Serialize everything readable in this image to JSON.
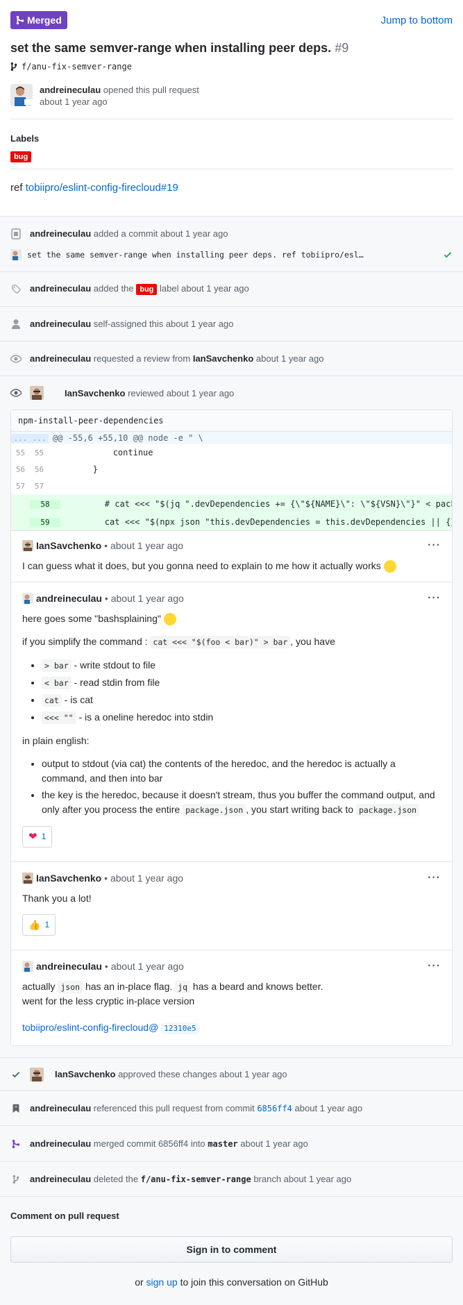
{
  "header": {
    "status": "Merged",
    "jump_link": "Jump to bottom",
    "title": "set the same semver-range when installing peer deps.",
    "number": "#9",
    "branch": "f/anu-fix-semver-range",
    "author": "andreineculau",
    "opened_text": "opened this pull request",
    "opened_time": "about 1 year ago"
  },
  "labels": {
    "heading": "Labels",
    "bug": "bug"
  },
  "body": {
    "prefix": "ref",
    "ref_link": "tobiipro/eslint-config-firecloud#19"
  },
  "timeline": {
    "commit": {
      "user": "andreineculau",
      "action": "added a commit",
      "time": "about 1 year ago",
      "message": "set the same semver-range when installing peer deps. ref tobiipro/esl…"
    },
    "labeled": {
      "user": "andreineculau",
      "action": "added the",
      "label": "bug",
      "suffix": "label about 1 year ago"
    },
    "assigned": {
      "user": "andreineculau",
      "action": "self-assigned this about 1 year ago"
    },
    "review_request": {
      "user": "andreineculau",
      "action": "requested a review from",
      "reviewer": "IanSavchenko",
      "time": "about 1 year ago"
    },
    "reviewed": {
      "user": "IanSavchenko",
      "action": "reviewed about 1 year ago"
    }
  },
  "review": {
    "file": "npm-install-peer-dependencies",
    "hunk": "@@ -55,6 +55,10 @@ node -e \" \\",
    "hunk_dots": "...",
    "rows": [
      {
        "l": "55",
        "r": "55",
        "code": "            continue"
      },
      {
        "l": "56",
        "r": "56",
        "code": "        }"
      },
      {
        "l": "57",
        "r": "57",
        "code": ""
      }
    ],
    "added": [
      {
        "r": "58",
        "code": "        # cat <<< \"$(jq \".devDependencies += {\\\"${NAME}\\\": \\\"${VSN}\\\"}\" < package.json)\" > package.json"
      },
      {
        "r": "59",
        "code": "        cat <<< \"$(npx json \"this.devDependencies = this.devDependencies || {}\" < package.json)\" > package.json"
      }
    ],
    "comments": [
      {
        "user": "IanSavchenko",
        "meta": "• about 1 year ago",
        "text": "I can guess what it does, but you gonna need to explain to me how it actually works"
      },
      {
        "user": "andreineculau",
        "meta": "• about 1 year ago",
        "intro": "here goes some \"bashsplaining\"",
        "simplify_pre": "if you simplify the command :",
        "simplify_code": "cat <<< \"$(foo < bar)\" > bar",
        "simplify_post": ", you have",
        "items": [
          {
            "code": "> bar",
            "text": "- write stdout to file"
          },
          {
            "code": "< bar",
            "text": "- read stdin from file"
          },
          {
            "code": "cat",
            "text": "- is cat"
          },
          {
            "code": "<<< \"\"",
            "text": "- is a oneline heredoc into stdin"
          }
        ],
        "plain": "in plain english:",
        "bullet1": "output to stdout (via cat) the contents of the heredoc, and the heredoc is actually a command, and then into bar",
        "bullet2_pre": "the key is the heredoc, because it doesn't stream, thus you buffer the command output, and only after you process the entire",
        "bullet2_code1": "package.json",
        "bullet2_mid": ", you start writing back to",
        "bullet2_code2": "package.json",
        "reaction_count": "1"
      },
      {
        "user": "IanSavchenko",
        "meta": "• about 1 year ago",
        "text": "Thank you a lot!",
        "reaction_count": "1"
      },
      {
        "user": "andreineculau",
        "meta": "• about 1 year ago",
        "pre": "actually",
        "code1": "json",
        "mid": "has an in-place flag.",
        "code2": "jq",
        "post": "has a beard and knows better.",
        "line2": "went for the less cryptic in-place version",
        "ref": "tobiipro/eslint-config-firecloud@",
        "sha": "12310e5"
      }
    ]
  },
  "events": {
    "approved": {
      "user": "IanSavchenko",
      "action": "approved these changes about 1 year ago"
    },
    "referenced": {
      "user": "andreineculau",
      "action": "referenced this pull request from commit",
      "sha": "6856ff4",
      "time": "about 1 year ago"
    },
    "merged": {
      "user": "andreineculau",
      "action": "merged commit 6856ff4 into",
      "branch": "master",
      "time": "about 1 year ago"
    },
    "deleted": {
      "user": "andreineculau",
      "action": "deleted the",
      "branch": "f/anu-fix-semver-range",
      "suffix": "branch about 1 year ago"
    }
  },
  "footer": {
    "comment_label": "Comment on pull request",
    "signin_button": "Sign in to comment",
    "join_pre": "or",
    "join_link": "sign up",
    "join_post": "to join this conversation on GitHub"
  },
  "colors": {
    "merged": "#6f42c1",
    "bug": "#ee0701",
    "link": "#0366d6",
    "check": "#28a745"
  }
}
